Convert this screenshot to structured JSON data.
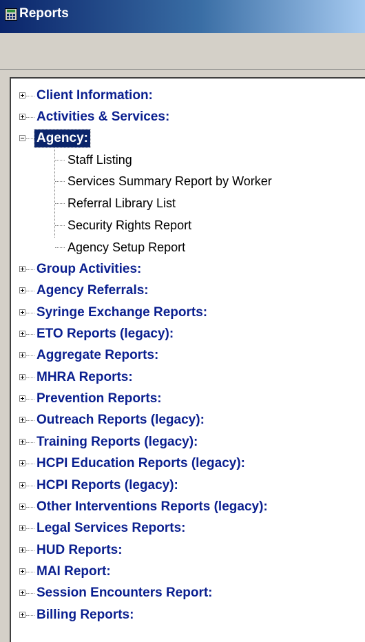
{
  "window": {
    "title": "Reports"
  },
  "tree": {
    "items_top_before": [
      {
        "label": "Client Information:"
      },
      {
        "label": "Activities & Services:"
      }
    ],
    "expanded": {
      "label": "Agency:",
      "children": [
        "Staff Listing",
        "Services Summary Report by Worker",
        "Referral Library List",
        "Security Rights Report",
        "Agency Setup Report"
      ]
    },
    "items_after": [
      "Group Activities:",
      "Agency Referrals:",
      "Syringe Exchange Reports:",
      "ETO Reports (legacy):",
      "Aggregate Reports:",
      "MHRA Reports:",
      "Prevention Reports:",
      "Outreach Reports (legacy):",
      "Training Reports (legacy):",
      "HCPI Education Reports (legacy):",
      "HCPI Reports (legacy):",
      "Other Interventions Reports (legacy):",
      "Legal Services Reports:",
      "HUD Reports:",
      "MAI Report:",
      "Session Encounters Report:",
      "Billing Reports:"
    ]
  }
}
